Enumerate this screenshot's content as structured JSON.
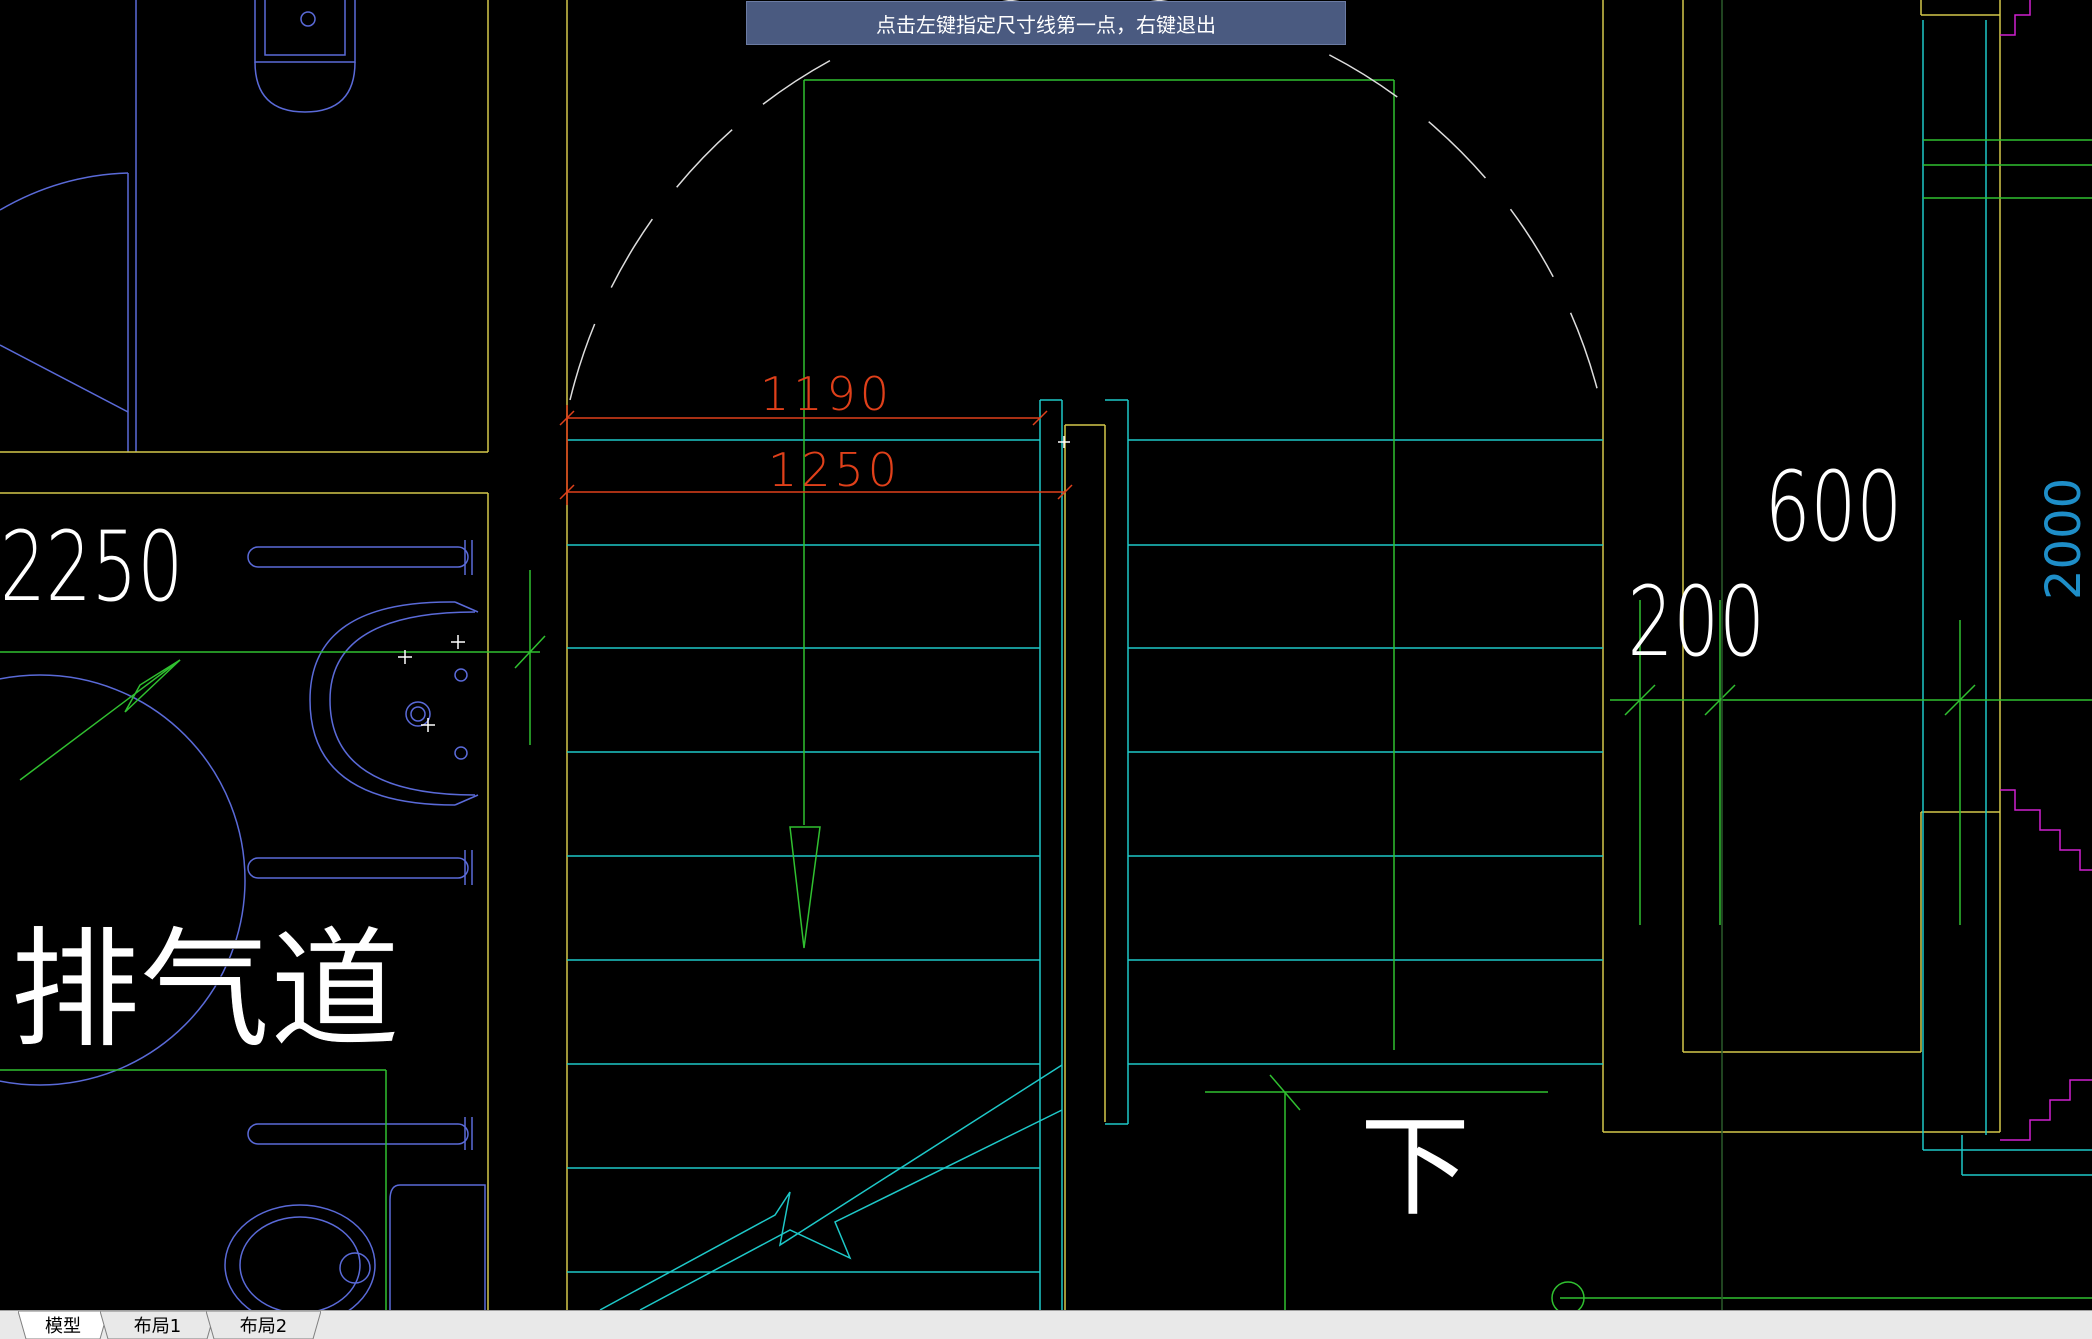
{
  "prompt": {
    "text": "点击左键指定尺寸线第一点，右键退出"
  },
  "dimensions": {
    "dim_1190": "1190",
    "dim_1250": "1250",
    "dim_2250": "2250",
    "dim_600": "600",
    "dim_200": "200"
  },
  "labels": {
    "exhaust_duct": "排气道",
    "down": "下"
  },
  "tabs": [
    {
      "label": "模型",
      "active": true
    },
    {
      "label": "布局1",
      "active": false
    },
    {
      "label": "布局2",
      "active": false
    }
  ],
  "colors": {
    "background": "#000000",
    "yellow": "#d4c84a",
    "cyan": "#1ec8c8",
    "green": "#30c030",
    "blue": "#5a6ad8",
    "red": "#e0401a",
    "magenta": "#d020d0",
    "white": "#ffffff",
    "prompt_bg": "#4a5a80"
  }
}
